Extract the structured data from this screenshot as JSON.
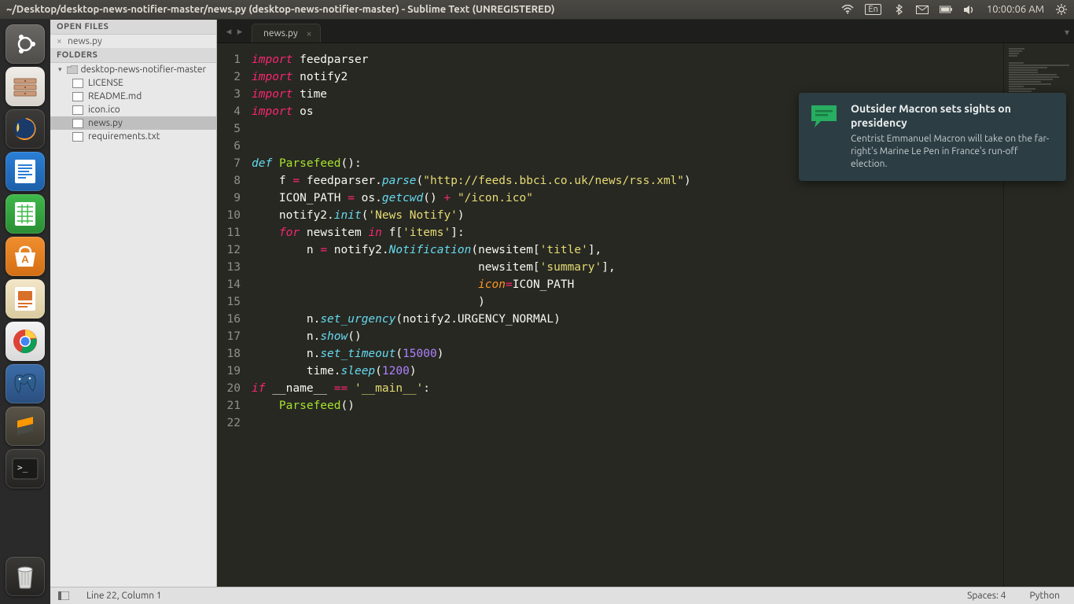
{
  "menubar": {
    "title": "~/Desktop/desktop-news-notifier-master/news.py (desktop-news-notifier-master) - Sublime Text (UNREGISTERED)",
    "lang_indicator": "En",
    "time": "10:00:06 AM"
  },
  "launcher": {
    "items": [
      {
        "name": "ubuntu-dash",
        "glyph": ""
      },
      {
        "name": "files",
        "glyph": ""
      },
      {
        "name": "firefox",
        "glyph": ""
      },
      {
        "name": "libreoffice-writer",
        "glyph": ""
      },
      {
        "name": "libreoffice-calc",
        "glyph": ""
      },
      {
        "name": "ubuntu-software",
        "glyph": "A"
      },
      {
        "name": "libreoffice-impress",
        "glyph": ""
      },
      {
        "name": "google-chrome",
        "glyph": ""
      },
      {
        "name": "postgresql",
        "glyph": ""
      },
      {
        "name": "sublime-text",
        "glyph": "S"
      },
      {
        "name": "terminal",
        "glyph": ">_"
      },
      {
        "name": "trash",
        "glyph": ""
      }
    ]
  },
  "sidebar": {
    "open_files_header": "OPEN FILES",
    "open_files": [
      {
        "label": "news.py"
      }
    ],
    "folders_header": "FOLDERS",
    "root_folder": "desktop-news-notifier-master",
    "files": [
      {
        "label": "LICENSE",
        "active": false
      },
      {
        "label": "README.md",
        "active": false
      },
      {
        "label": "icon.ico",
        "active": false
      },
      {
        "label": "news.py",
        "active": true
      },
      {
        "label": "requirements.txt",
        "active": false
      }
    ]
  },
  "tabs": {
    "active": "news.py"
  },
  "code": {
    "lines": 22,
    "tokens": [
      [
        [
          "kw",
          "import"
        ],
        [
          "var",
          " feedparser"
        ]
      ],
      [
        [
          "kw",
          "import"
        ],
        [
          "var",
          " notify2"
        ]
      ],
      [
        [
          "kw",
          "import"
        ],
        [
          "var",
          " time"
        ]
      ],
      [
        [
          "kw",
          "import"
        ],
        [
          "var",
          " os"
        ]
      ],
      [],
      [],
      [
        [
          "def",
          "def"
        ],
        [
          "var",
          " "
        ],
        [
          "fn",
          "Parsefeed"
        ],
        [
          "var",
          "():"
        ]
      ],
      [
        [
          "var",
          "    f "
        ],
        [
          "op",
          "="
        ],
        [
          "var",
          " feedparser"
        ],
        [
          "var",
          "."
        ],
        [
          "cls",
          "parse"
        ],
        [
          "var",
          "("
        ],
        [
          "str",
          "\"http://feeds.bbci.co.uk/news/rss.xml\""
        ],
        [
          "var",
          ")"
        ]
      ],
      [
        [
          "var",
          "    ICON_PATH "
        ],
        [
          "op",
          "="
        ],
        [
          "var",
          " os"
        ],
        [
          "var",
          "."
        ],
        [
          "cls",
          "getcwd"
        ],
        [
          "var",
          "() "
        ],
        [
          "op",
          "+"
        ],
        [
          "var",
          " "
        ],
        [
          "str",
          "\"/icon.ico\""
        ]
      ],
      [
        [
          "var",
          "    notify2"
        ],
        [
          "var",
          "."
        ],
        [
          "cls",
          "init"
        ],
        [
          "var",
          "("
        ],
        [
          "str",
          "'News Notify'"
        ],
        [
          "var",
          ")"
        ]
      ],
      [
        [
          "var",
          "    "
        ],
        [
          "kw",
          "for"
        ],
        [
          "var",
          " newsitem "
        ],
        [
          "kw",
          "in"
        ],
        [
          "var",
          " f["
        ],
        [
          "str",
          "'items'"
        ],
        [
          "var",
          "]:"
        ]
      ],
      [
        [
          "var",
          "        n "
        ],
        [
          "op",
          "="
        ],
        [
          "var",
          " notify2"
        ],
        [
          "var",
          "."
        ],
        [
          "cls",
          "Notification"
        ],
        [
          "var",
          "(newsitem["
        ],
        [
          "str",
          "'title'"
        ],
        [
          "var",
          "],"
        ]
      ],
      [
        [
          "var",
          "                                 newsitem["
        ],
        [
          "str",
          "'summary'"
        ],
        [
          "var",
          "],"
        ]
      ],
      [
        [
          "var",
          "                                 "
        ],
        [
          "par",
          "icon"
        ],
        [
          "op",
          "="
        ],
        [
          "var",
          "ICON_PATH"
        ]
      ],
      [
        [
          "var",
          "                                 )"
        ]
      ],
      [
        [
          "var",
          "        n"
        ],
        [
          "var",
          "."
        ],
        [
          "cls",
          "set_urgency"
        ],
        [
          "var",
          "(notify2"
        ],
        [
          "var",
          "."
        ],
        [
          "var",
          "URGENCY_NORMAL)"
        ]
      ],
      [
        [
          "var",
          "        n"
        ],
        [
          "var",
          "."
        ],
        [
          "cls",
          "show"
        ],
        [
          "var",
          "()"
        ]
      ],
      [
        [
          "var",
          "        n"
        ],
        [
          "var",
          "."
        ],
        [
          "cls",
          "set_timeout"
        ],
        [
          "var",
          "("
        ],
        [
          "num",
          "15000"
        ],
        [
          "var",
          ")"
        ]
      ],
      [
        [
          "var",
          "        time"
        ],
        [
          "var",
          "."
        ],
        [
          "cls",
          "sleep"
        ],
        [
          "var",
          "("
        ],
        [
          "num",
          "1200"
        ],
        [
          "var",
          ")"
        ]
      ],
      [
        [
          "kw",
          "if"
        ],
        [
          "var",
          " __name__ "
        ],
        [
          "op",
          "=="
        ],
        [
          "var",
          " "
        ],
        [
          "str",
          "'__main__'"
        ],
        [
          "var",
          ":"
        ]
      ],
      [
        [
          "var",
          "    "
        ],
        [
          "fn",
          "Parsefeed"
        ],
        [
          "var",
          "()"
        ]
      ],
      []
    ]
  },
  "statusbar": {
    "lincol": "Line 22, Column 1",
    "spaces": "Spaces: 4",
    "syntax": "Python"
  },
  "notification": {
    "title": "Outsider Macron sets sights on presidency",
    "body": "Centrist Emmanuel Macron will take on the far-right's Marine Le Pen in France's run-off election."
  }
}
